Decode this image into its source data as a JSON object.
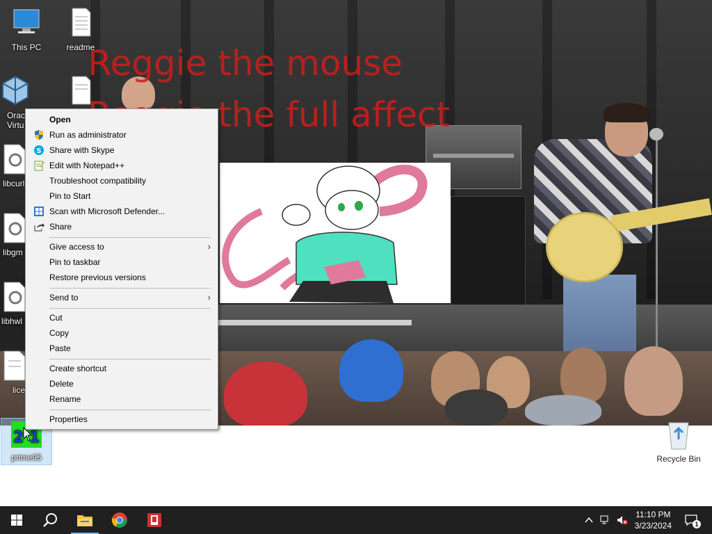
{
  "wallpaper": {
    "text_lines": [
      "Reggie the mouse",
      "Reggie the full affect"
    ],
    "text_color": "#d11c1c"
  },
  "desktop_icons": [
    {
      "label": "This PC",
      "icon": "this-pc-icon"
    },
    {
      "label": "readme",
      "icon": "text-file-icon"
    },
    {
      "label": "Oracl Virtu",
      "icon": "virtualbox-icon"
    },
    {
      "label": "",
      "icon": "text-file-icon"
    },
    {
      "label": "libcurl",
      "icon": "settings-file-icon"
    },
    {
      "label": "libgm",
      "icon": "settings-file-icon"
    },
    {
      "label": "libhwl",
      "icon": "settings-file-icon"
    },
    {
      "label": "lice",
      "icon": "text-file-icon"
    },
    {
      "label": "prime95",
      "icon": "prime95-icon"
    },
    {
      "label": "Recycle Bin",
      "icon": "recycle-bin-icon"
    }
  ],
  "prime95_icon_text": "2 1",
  "context_menu": {
    "items": [
      {
        "label": "Open",
        "icon": "",
        "bold": true
      },
      {
        "label": "Run as administrator",
        "icon": "uac-shield-icon"
      },
      {
        "label": "Share with Skype",
        "icon": "skype-icon"
      },
      {
        "label": "Edit with Notepad++",
        "icon": "notepadpp-icon"
      },
      {
        "label": "Troubleshoot compatibility",
        "icon": ""
      },
      {
        "label": "Pin to Start",
        "icon": ""
      },
      {
        "label": "Scan with Microsoft Defender...",
        "icon": "defender-icon"
      },
      {
        "label": "Share",
        "icon": "share-icon"
      },
      {
        "label": "Give access to",
        "icon": "",
        "submenu": true
      },
      {
        "label": "Pin to taskbar",
        "icon": ""
      },
      {
        "label": "Restore previous versions",
        "icon": ""
      },
      {
        "label": "Send to",
        "icon": "",
        "submenu": true
      },
      {
        "label": "Cut",
        "icon": ""
      },
      {
        "label": "Copy",
        "icon": ""
      },
      {
        "label": "Paste",
        "icon": ""
      },
      {
        "label": "Create shortcut",
        "icon": ""
      },
      {
        "label": "Delete",
        "icon": ""
      },
      {
        "label": "Rename",
        "icon": ""
      },
      {
        "label": "Properties",
        "icon": ""
      }
    ],
    "submenu_arrow": "›"
  },
  "taskbar": {
    "buttons": [
      {
        "name": "start",
        "icon": "windows-logo-icon"
      },
      {
        "name": "search",
        "icon": "search-icon"
      },
      {
        "name": "file-explorer",
        "icon": "folder-icon"
      },
      {
        "name": "chrome",
        "icon": "chrome-icon"
      },
      {
        "name": "app",
        "icon": "red-app-icon"
      }
    ],
    "time": "11:10 PM",
    "date": "3/23/2024",
    "notification_count": "1",
    "accent": "#76b9ed"
  }
}
